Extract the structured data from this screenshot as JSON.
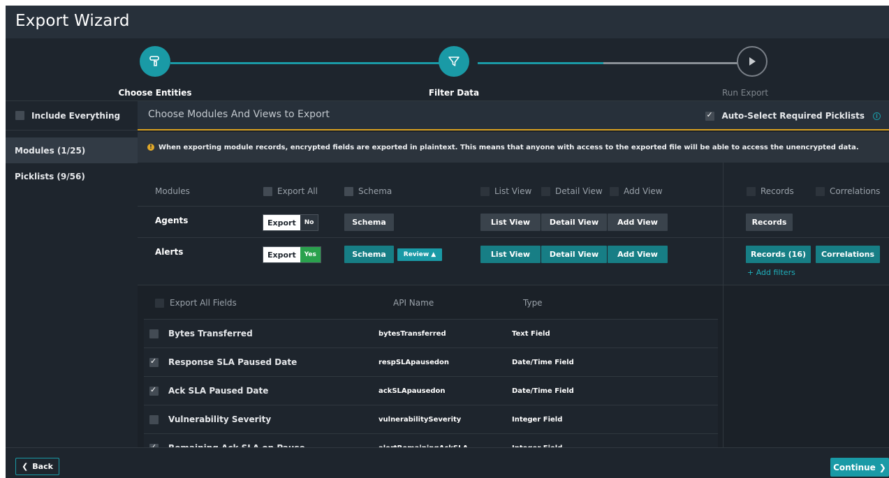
{
  "header": {
    "title": "Export Wizard"
  },
  "steps": [
    {
      "label": "Choose Entities",
      "state": "complete",
      "icon": "pointer-hand-icon"
    },
    {
      "label": "Filter Data",
      "state": "active",
      "icon": "filter-funnel-icon"
    },
    {
      "label": "Run Export",
      "state": "inactive",
      "icon": "play-icon"
    }
  ],
  "sidebar": {
    "include_everything": "Include Everything",
    "items": [
      {
        "label": "Modules (1/25)",
        "active": true
      },
      {
        "label": "Picklists (9/56)",
        "active": false
      }
    ]
  },
  "main": {
    "title": "Choose Modules And Views to Export",
    "auto_select": {
      "label": "Auto-Select Required Picklists",
      "checked": true
    },
    "warning": "When exporting module records, encrypted fields are exported in plaintext. This means that anyone with access to the exported file will be able to access the unencrypted data.",
    "columns": {
      "modules": "Modules",
      "export_all": "Export All",
      "schema": "Schema",
      "list_view": "List View",
      "detail_view": "Detail View",
      "add_view": "Add View",
      "records": "Records",
      "correlations": "Correlations"
    },
    "rows": [
      {
        "name": "Agents",
        "export_label": "Export",
        "export_value": "No",
        "schema": "Schema",
        "list_view": "List View",
        "detail_view": "Detail View",
        "add_view": "Add View",
        "records": "Records"
      },
      {
        "name": "Alerts",
        "export_label": "Export",
        "export_value": "Yes",
        "schema": "Schema",
        "review": "Review ▲",
        "list_view": "List View",
        "detail_view": "Detail View",
        "add_view": "Add View",
        "records": "Records (16)",
        "correlations": "Correlations",
        "add_filters": "+ Add filters"
      }
    ]
  },
  "fields_table": {
    "headers": {
      "export_all_fields": "Export All Fields",
      "api_name": "API Name",
      "type": "Type"
    },
    "rows": [
      {
        "name": "Bytes Transferred",
        "api": "bytesTransferred",
        "type": "Text Field",
        "checked": false
      },
      {
        "name": "Response SLA Paused Date",
        "api": "respSLApausedon",
        "type": "Date/Time Field",
        "checked": true
      },
      {
        "name": "Ack SLA Paused Date",
        "api": "ackSLApausedon",
        "type": "Date/Time Field",
        "checked": true
      },
      {
        "name": "Vulnerability Severity",
        "api": "vulnerabilitySeverity",
        "type": "Integer Field",
        "checked": false
      },
      {
        "name": "Remaining Ack SLA on Pause",
        "api": "alertRemainingAckSLA",
        "type": "Integer Field",
        "checked": true
      }
    ]
  },
  "footer": {
    "back": "Back",
    "continue": "Continue"
  },
  "colors": {
    "accent": "#1a9aa6",
    "warning": "#d8a020",
    "yes": "#2aa14d",
    "background": "#1e252d"
  }
}
